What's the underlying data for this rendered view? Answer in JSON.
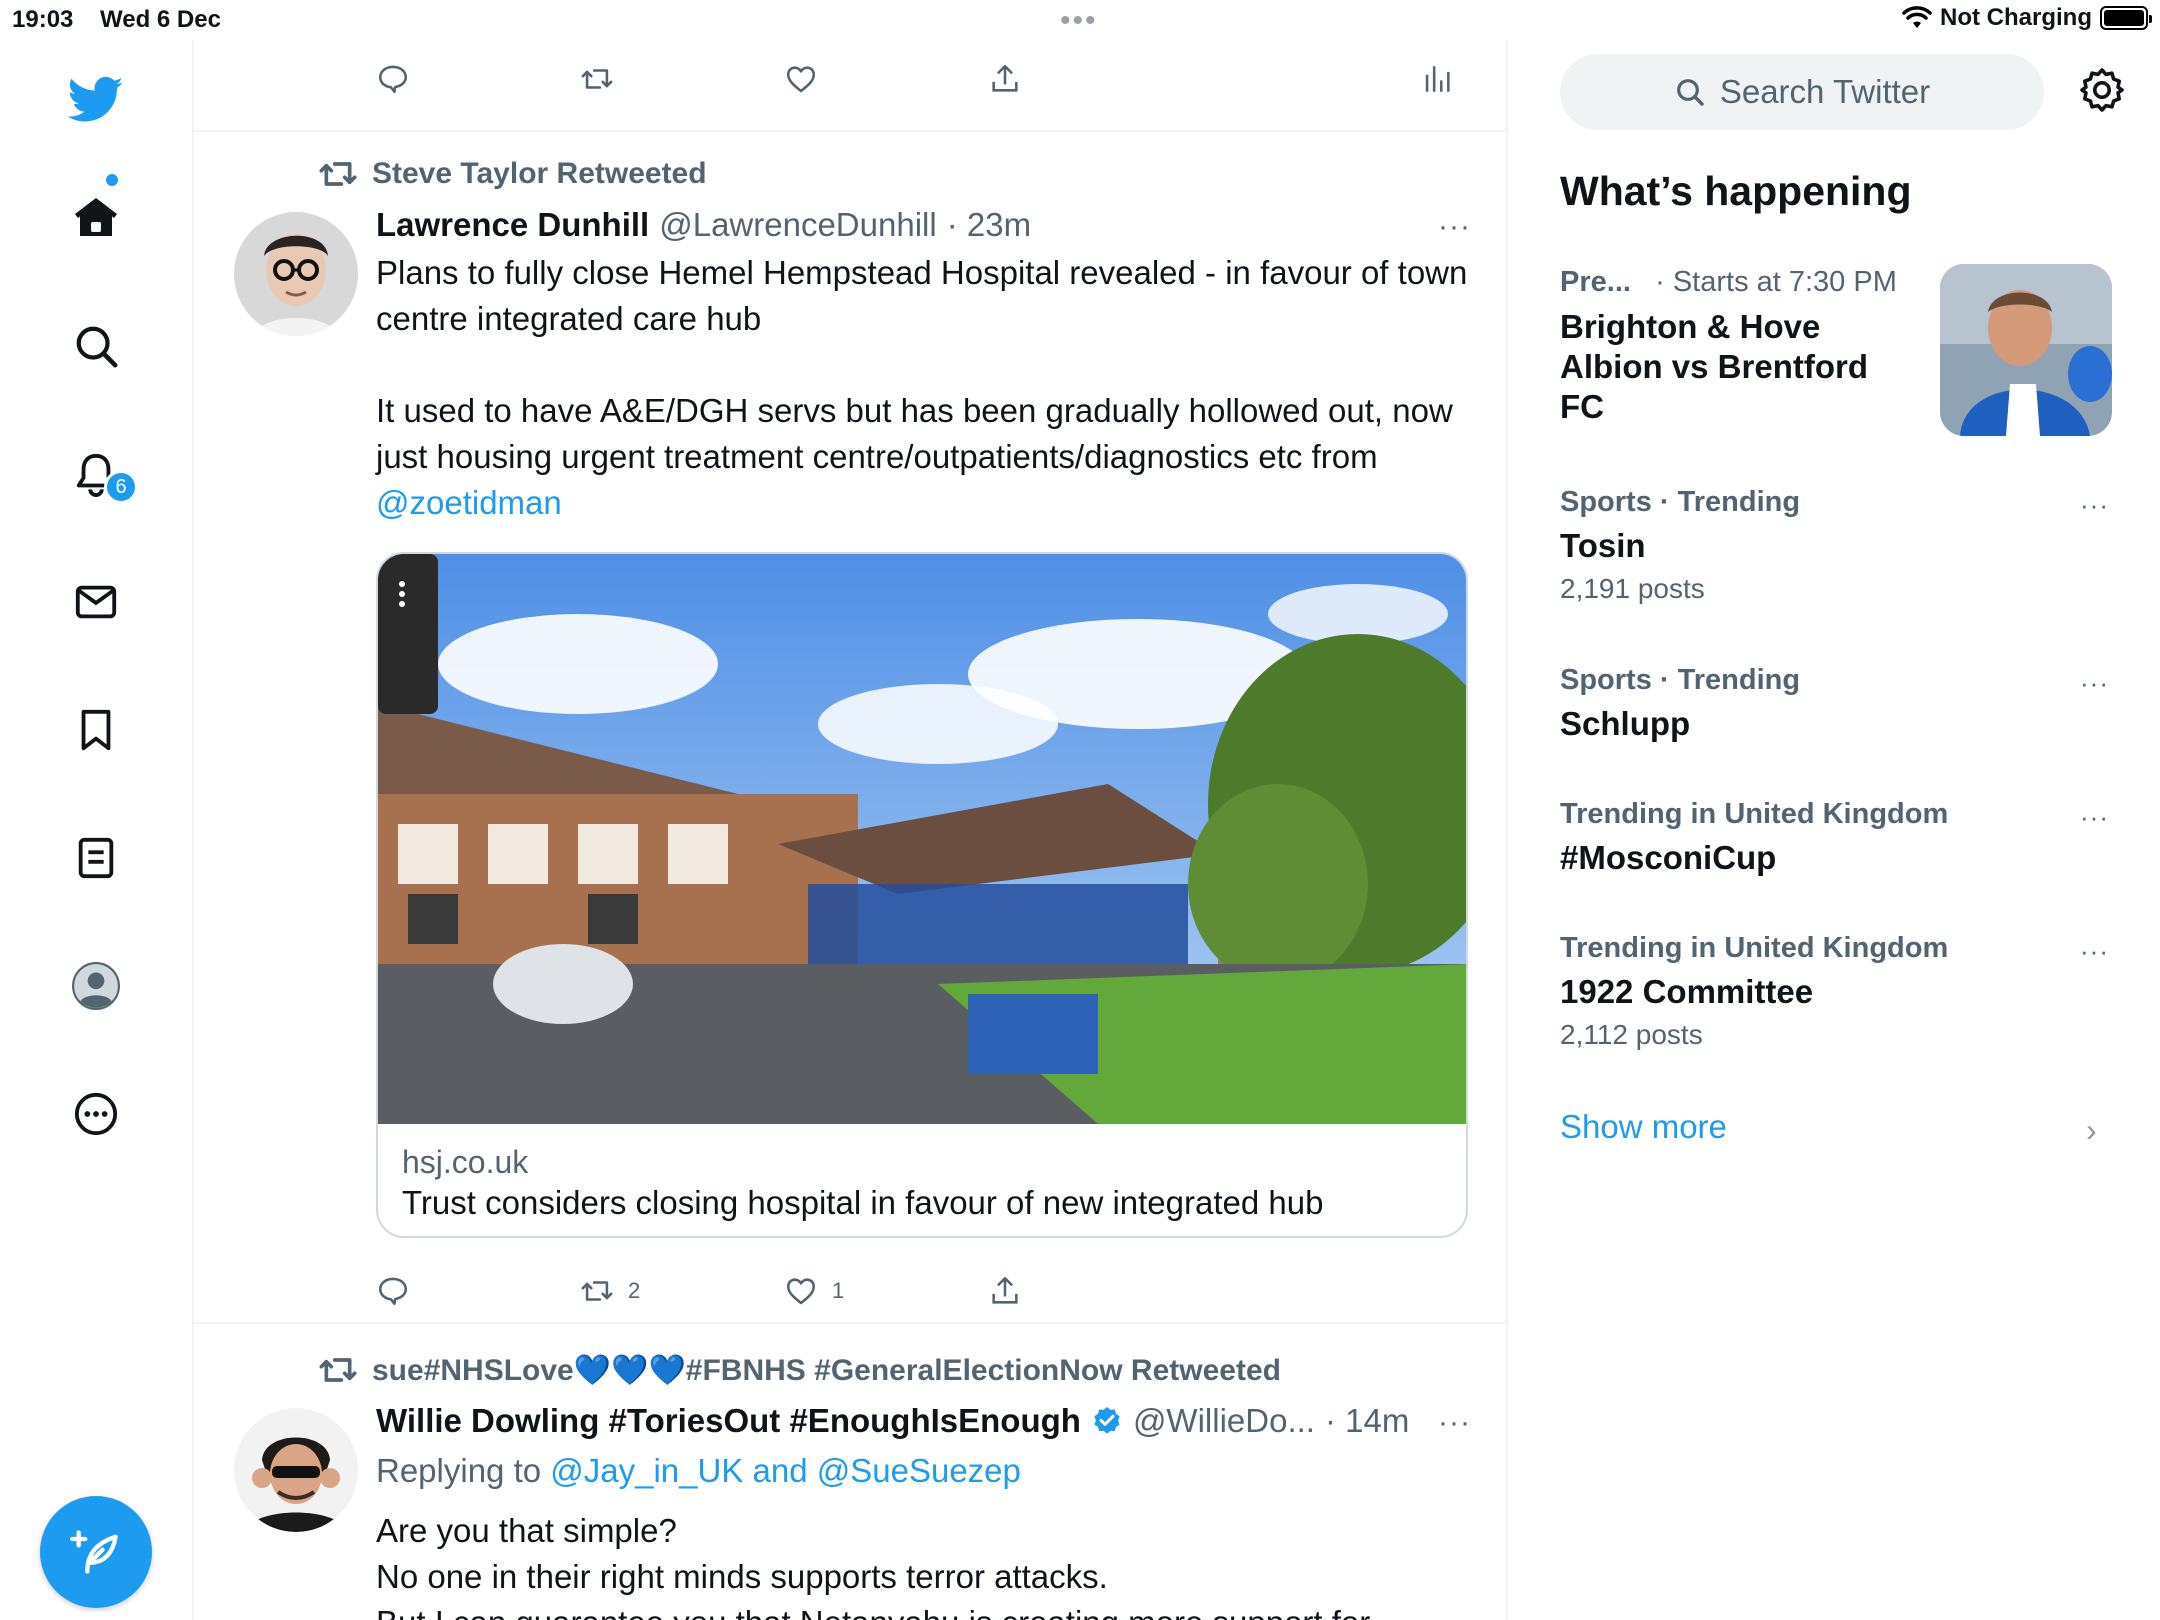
{
  "status_bar": {
    "time": "19:03",
    "date": "Wed 6 Dec",
    "multitask_dots": "•••",
    "charging": "Not Charging"
  },
  "nav": {
    "notifications_badge": "6",
    "accent": "#1d9bf0"
  },
  "tweets": [
    {
      "retweeted_by": "Steve Taylor Retweeted",
      "name": "Lawrence Dunhill",
      "handle": "@LawrenceDunhill",
      "time": "· 23m",
      "more": "···",
      "paragraph1": "Plans to fully close Hemel Hempstead Hospital revealed - in favour of town centre integrated care hub",
      "paragraph2": "It used to have A&E/DGH servs but has been gradually hollowed out, now just housing urgent treatment centre/outpatients/diagnostics etc from ",
      "mention": "@zoetidman",
      "card": {
        "domain": "hsj.co.uk",
        "title": "Trust considers closing hospital in favour of new integrated hub"
      },
      "retweets": "2",
      "likes": "1"
    },
    {
      "retweeted_by": "sue#NHSLove💙💙💙#FBNHS #GeneralElectionNow Retweeted",
      "name": "Willie Dowling #ToriesOut #EnoughIsEnough",
      "handle": "@WillieDo...",
      "time": "· 14m",
      "more": "···",
      "replying_prefix": "Replying to ",
      "replying_to": "@Jay_in_UK and @SueSuezep",
      "line1": "Are you that simple?",
      "line2": "No one in their right minds supports terror attacks.",
      "line3": "But I can guarantee you that Netanyahu is creating more support for"
    }
  ],
  "sidebar": {
    "search_placeholder": "Search Twitter",
    "whats_happening": "What’s happening",
    "event": {
      "category": "Pre...",
      "time": "· Starts at 7:30 PM",
      "title": "Brighton & Hove Albion vs Brentford FC"
    },
    "trends": [
      {
        "category": "Sports · Trending",
        "name": "Tosin",
        "posts": "2,191 posts"
      },
      {
        "category": "Sports · Trending",
        "name": "Schlupp",
        "posts": ""
      },
      {
        "category": "Trending in United Kingdom",
        "name": "#MosconiCup",
        "posts": ""
      },
      {
        "category": "Trending in United Kingdom",
        "name": "1922 Committee",
        "posts": "2,112 posts"
      }
    ],
    "trend_more": "···",
    "show_more": "Show more",
    "show_more_chevron": "›"
  }
}
